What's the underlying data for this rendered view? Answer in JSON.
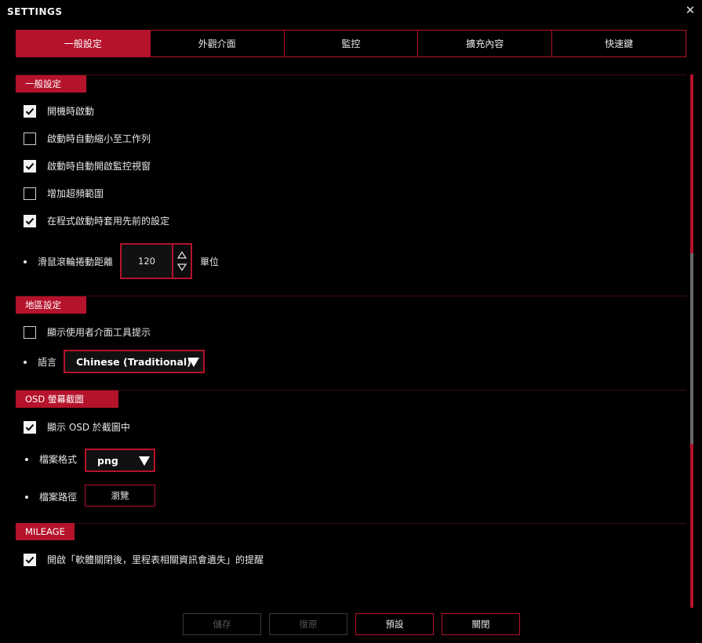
{
  "window": {
    "title": "SETTINGS",
    "close_glyph": "✕"
  },
  "tabs": [
    {
      "label": "一般設定",
      "active": true
    },
    {
      "label": "外觀介面",
      "active": false
    },
    {
      "label": "監控",
      "active": false
    },
    {
      "label": "擴充內容",
      "active": false
    },
    {
      "label": "快速鍵",
      "active": false
    }
  ],
  "general": {
    "header": "一般設定",
    "options": [
      {
        "label": "開機時啟動",
        "checked": true
      },
      {
        "label": "啟動時自動縮小至工作列",
        "checked": false
      },
      {
        "label": "啟動時自動開啟監控視窗",
        "checked": true
      },
      {
        "label": "增加超頻範圍",
        "checked": false
      },
      {
        "label": "在程式啟動時套用先前的設定",
        "checked": true
      }
    ],
    "scroll_label": "滑鼠滾輪捲動距離",
    "scroll_value": "120",
    "scroll_unit": "單位"
  },
  "region": {
    "header": "地區設定",
    "tooltip_option": {
      "label": "顯示使用者介面工具提示",
      "checked": false
    },
    "language_label": "語言",
    "language_value": "Chinese (Traditional)"
  },
  "osd": {
    "header": "OSD 螢幕截圖",
    "show_osd_option": {
      "label": "顯示 OSD 於截圖中",
      "checked": true
    },
    "format_label": "檔案格式",
    "format_value": "png",
    "path_label": "檔案路徑",
    "browse_label": "瀏覽"
  },
  "mileage": {
    "header": "MILEAGE",
    "reminder_option": {
      "label": "開啟「軟體關閉後，里程表相關資訊會遺失」的提醒",
      "checked": true
    }
  },
  "footer": {
    "save_label": "儲存",
    "save_enabled": false,
    "restore_label": "復原",
    "restore_enabled": false,
    "default_label": "預設",
    "close_label": "關閉"
  },
  "colors": {
    "accent": "#b5122b",
    "background": "#000000",
    "text": "#e6e6e6"
  }
}
